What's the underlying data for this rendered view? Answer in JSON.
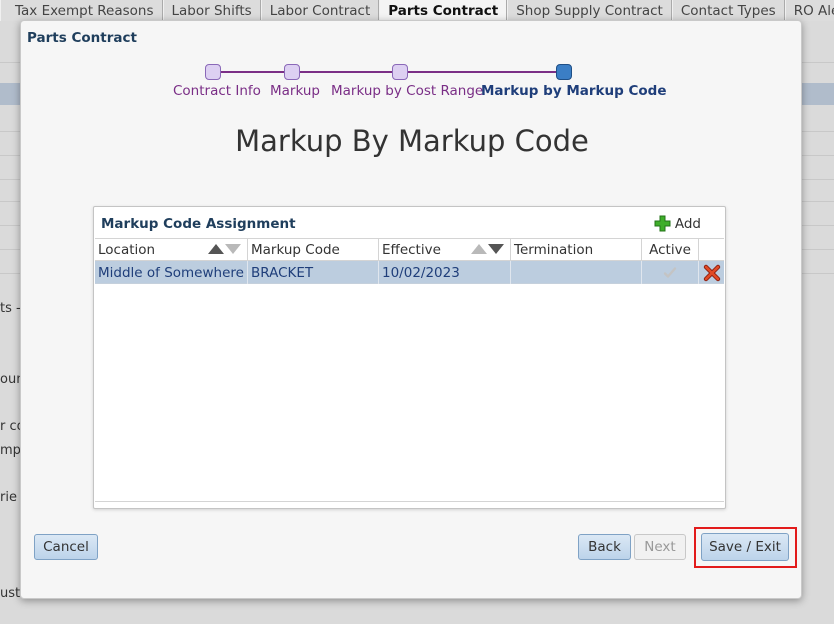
{
  "background": {
    "tabs": [
      "Tax Exempt Reasons",
      "Labor Shifts",
      "Labor Contract",
      "Parts Contract",
      "Shop Supply Contract",
      "Contact Types",
      "RO Alerts"
    ],
    "active_tab": "Parts Contract",
    "fragments": [
      "ts -",
      "oun",
      "r co",
      "mplo",
      "rie",
      "usto"
    ]
  },
  "dialog": {
    "title": "Parts Contract",
    "heading": "Markup By Markup Code",
    "train": {
      "steps": [
        "Contract Info",
        "Markup",
        "Markup by Cost Range",
        "Markup by Markup Code"
      ],
      "current_step": "Markup by Markup Code"
    },
    "panel": {
      "title": "Markup Code Assignment",
      "add_label": "Add",
      "columns": [
        "Location",
        "Markup Code",
        "Effective",
        "Termination",
        "Active"
      ],
      "rows": [
        {
          "location": "Middle of Somewhere ...",
          "markup_code": "BRACKET",
          "effective": "10/02/2023",
          "termination": "",
          "active": true
        }
      ]
    },
    "buttons": {
      "cancel": "Cancel",
      "back": "Back",
      "next": "Next",
      "save_exit": "Save / Exit"
    }
  },
  "colors": {
    "train_line": "#7b2f86",
    "selected_row": "#bccddf",
    "highlight": "#e21b1b"
  }
}
